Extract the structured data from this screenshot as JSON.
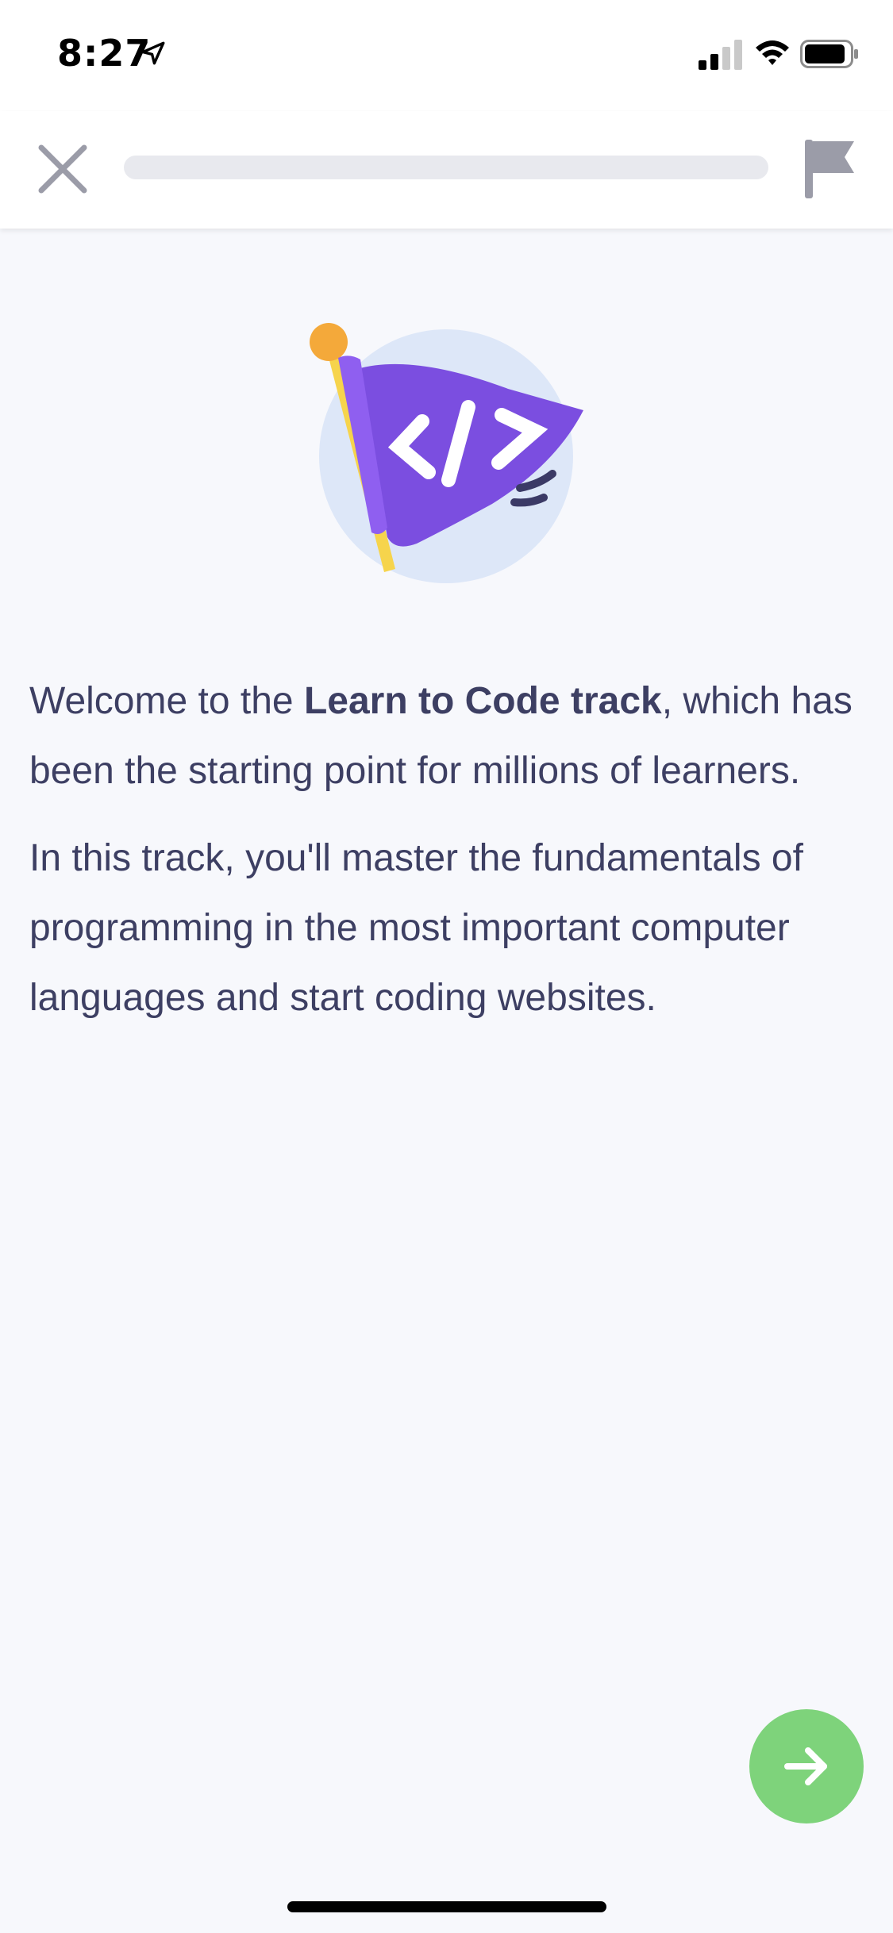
{
  "status_bar": {
    "time": "8:27",
    "icons": [
      "location-arrow-icon",
      "cellular-signal-icon",
      "wifi-icon",
      "battery-icon"
    ]
  },
  "top_nav": {
    "close_icon": "close-icon",
    "progress_fraction": 0,
    "flag_icon": "flag-icon"
  },
  "illustration": {
    "name": "code-flag-illustration",
    "flag_glyph": "</>",
    "colors": {
      "circle": "#dde7f8",
      "flag": "#7b4ee0",
      "pole": "#f6d44c",
      "knob": "#f4a93a"
    }
  },
  "content": {
    "paragraph1_before": "Welcome to the ",
    "paragraph1_bold": "Learn to Code track",
    "paragraph1_after": ", which has been the starting point for millions of learners.",
    "paragraph2": "In this track, you'll master the fundamentals of programming in the most important computer languages and start coding websites."
  },
  "next_button": {
    "icon": "arrow-right-icon",
    "color": "#7ed37b"
  },
  "colors": {
    "background": "#f7f8fc",
    "text": "#3d3f63",
    "progress_track": "#e8e9ee",
    "icon_gray": "#9b9ca8"
  }
}
